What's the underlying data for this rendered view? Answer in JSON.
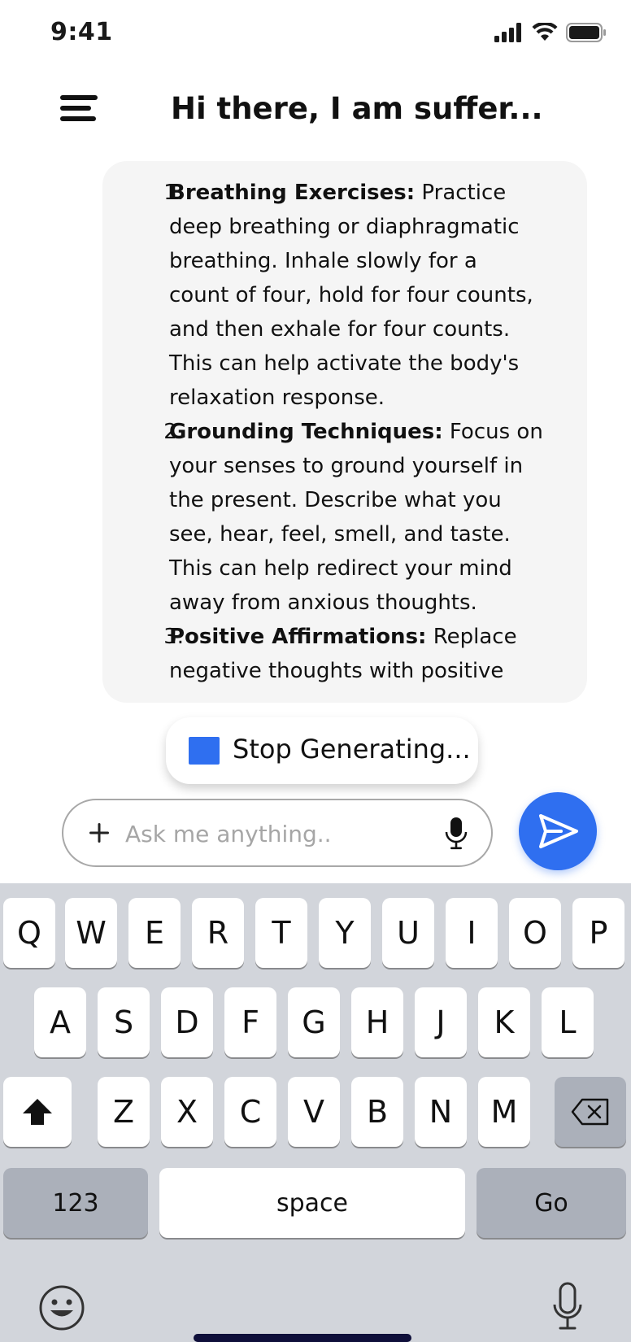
{
  "status_bar": {
    "time": "9:41",
    "icons": [
      "cellular-signal-icon",
      "wifi-icon",
      "battery-icon"
    ]
  },
  "header": {
    "menu_icon": "menu-icon",
    "title": "Hi there, I am suffer..."
  },
  "response": {
    "items": [
      {
        "number": "1.",
        "title": "Breathing Exercises:",
        "lines": [
          "Practice",
          "deep breathing or diaphragmatic",
          "breathing. Inhale slowly for a",
          "count of four, hold for four counts,",
          "and then exhale for four counts.",
          "This can help activate the body's",
          "relaxation response."
        ]
      },
      {
        "number": "2.",
        "title": "Grounding Techniques:",
        "lines": [
          "Focus on",
          "your senses to ground yourself in",
          "the present. Describe what you",
          "see, hear, feel, smell, and taste.",
          "This can help redirect your mind",
          "away from anxious thoughts."
        ]
      },
      {
        "number": "3.",
        "title": "Positive Affirmations:",
        "lines": [
          "Replace",
          "negative thoughts with positive"
        ]
      }
    ]
  },
  "stop_button": {
    "label": "Stop Generating...",
    "icon": "stop-square-icon",
    "icon_color": "#2F6FF0"
  },
  "composer": {
    "value": "",
    "placeholder": "Ask me anything..",
    "add_icon": "plus-icon",
    "mic_icon": "microphone-icon",
    "send_icon": "send-icon",
    "send_color": "#2F6FF0"
  },
  "keyboard": {
    "row1": [
      "Q",
      "W",
      "E",
      "R",
      "T",
      "Y",
      "U",
      "I",
      "O",
      "P"
    ],
    "row2": [
      "A",
      "S",
      "D",
      "F",
      "G",
      "H",
      "J",
      "K",
      "L"
    ],
    "row3": [
      "Z",
      "X",
      "C",
      "V",
      "B",
      "N",
      "M"
    ],
    "shift_icon": "shift-icon",
    "backspace_icon": "backspace-icon",
    "numbers_label": "123",
    "space_label": "space",
    "go_label": "Go",
    "emoji_icon": "emoji-icon",
    "dictation_icon": "dictation-mic-icon"
  }
}
